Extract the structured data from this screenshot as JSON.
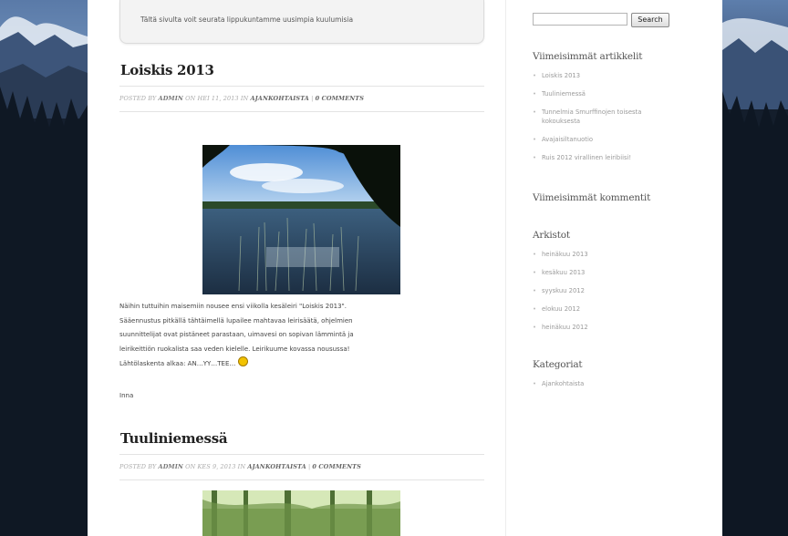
{
  "intro": {
    "text": "Tältä sivulta voit seurata lippukuntamme uusimpia kuulumisia"
  },
  "posts": [
    {
      "title": "Loiskis 2013",
      "meta": {
        "prefix": "POSTED BY",
        "author": "ADMIN",
        "on": "ON",
        "date": "HEI 11, 2013",
        "in": "IN",
        "category": "AJANKOHTAISTA",
        "sep": "|",
        "comments": "0 COMMENTS"
      },
      "body_lines": [
        "Näihin tuttuihin maisemiin nousee ensi viikolla kesäleiri \"Loiskis 2013\".",
        "Sääennustus pitkällä tähtäimellä lupailee mahtavaa leirisäätä, ohjelmien",
        "suunnittelijat ovat pistäneet parastaan, uimavesi on sopivan lämmintä ja",
        "leirikeittiön ruokalista saa veden kielelle. Leirikuume kovassa nousussa!",
        "Lähtölaskenta alkaa: AN…YY…TEE…"
      ],
      "signature": "Inna"
    },
    {
      "title": "Tuuliniemessä",
      "meta": {
        "prefix": "POSTED BY",
        "author": "ADMIN",
        "on": "ON",
        "date": "KES 9, 2013",
        "in": "IN",
        "category": "AJANKOHTAISTA",
        "sep": "|",
        "comments": "0 COMMENTS"
      }
    }
  ],
  "search": {
    "button_label": "Search",
    "value": ""
  },
  "sidebar": {
    "recent_posts": {
      "title": "Viimeisimmät artikkelit",
      "items": [
        "Loiskis 2013",
        "Tuuliniemessä",
        "Tunnelmia Smurffinojen toisesta",
        "kokouksesta",
        "Avajaisiltanuotio",
        "Ruis 2012 virallinen leiribiisi!"
      ]
    },
    "recent_comments": {
      "title": "Viimeisimmät kommentit"
    },
    "archives": {
      "title": "Arkistot",
      "items": [
        "heinäkuu 2013",
        "kesäkuu 2013",
        "syyskuu 2012",
        "elokuu 2012",
        "heinäkuu 2012"
      ]
    },
    "categories": {
      "title": "Kategoriat",
      "items": [
        "Ajankohtaista"
      ]
    }
  },
  "colors": {
    "background": "#1d2a3e",
    "page": "#ffffff",
    "text": "#444444",
    "muted": "#9a9a9a"
  }
}
